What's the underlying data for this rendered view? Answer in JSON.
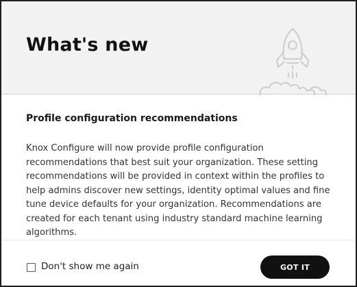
{
  "dialog": {
    "title": "What's new",
    "illustration_icon": "rocket-icon",
    "section_title": "Profile configuration recommendations",
    "description": "Knox Configure will now provide profile configuration recommendations that best suit your organization. These setting recommendations will be provided in context within the profiles to help admins discover new settings, identity optimal values and fine tune device defaults for your organization. Recommendations are created for each tenant using industry standard machine learning algorithms.",
    "checkbox": {
      "label": "Don't show me again",
      "checked": false
    },
    "primary_button": "GOT IT"
  },
  "colors": {
    "header_background": "#f2f2f2",
    "button_background": "#111111",
    "button_text": "#ffffff",
    "illustration_stroke": "#cfcfcf"
  }
}
